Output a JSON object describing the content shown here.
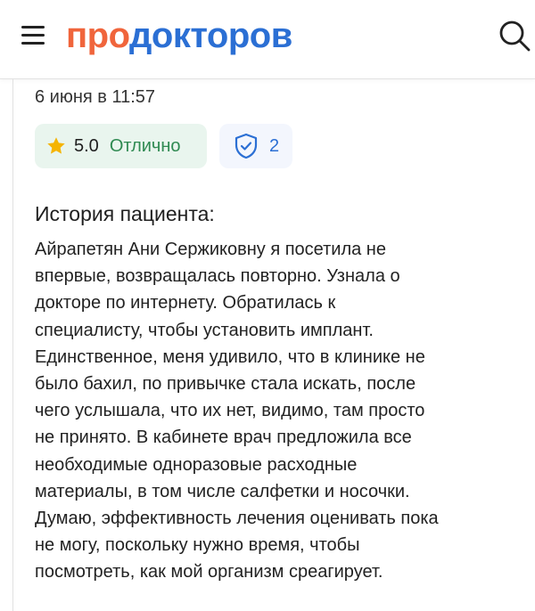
{
  "header": {
    "logo_part1": "про",
    "logo_part2": "докторов",
    "menu_icon": "hamburger-icon",
    "search_icon": "search-icon"
  },
  "review": {
    "date": "6 июня в 11:57",
    "rating_value": "5.0",
    "rating_label": "Отлично",
    "verified_count": "2",
    "section_title": "История пациента:",
    "story_lines": [
      "Айрапетян Ани Сержиковну я посетила не",
      "впервые, возвращалась повторно. Узнала о",
      "докторе по интернету. Обратилась к",
      "специалисту, чтобы установить имплант.",
      "Единственное, меня удивило, что в клинике не",
      "было бахил, по привычке стала искать, после",
      "чего услышала, что их нет, видимо, там просто",
      "не принято. В кабинете врач предложила все",
      "необходимые одноразовые расходные",
      "материалы, в том числе салфетки и носочки.",
      "Думаю, эффективность лечения оценивать пока",
      "не могу, поскольку нужно время, чтобы",
      "посмотреть, как мой организм среагирует."
    ]
  },
  "colors": {
    "logo_orange": "#f0653c",
    "logo_blue": "#2b6fd4",
    "rating_green": "#2f8a52",
    "rating_bg": "#e9f5ee",
    "star": "#f5b400"
  }
}
